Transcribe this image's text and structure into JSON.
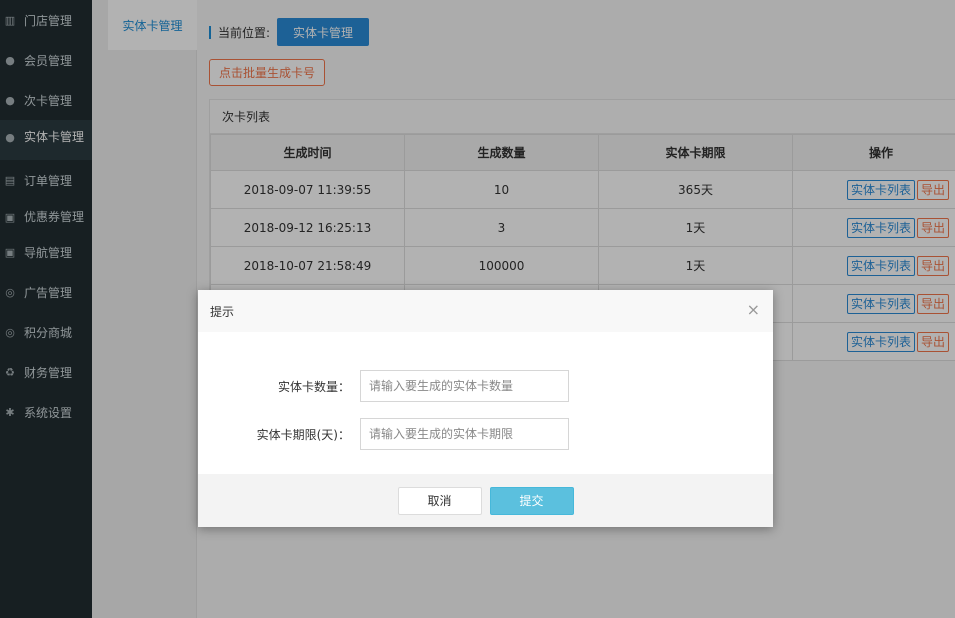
{
  "sidebar": {
    "items": [
      {
        "icon": "bank-icon",
        "glyph": "▥",
        "label": "门店管理"
      },
      {
        "icon": "user-icon",
        "glyph": "●",
        "label": "会员管理"
      },
      {
        "icon": "user-icon",
        "glyph": "●",
        "label": "次卡管理"
      },
      {
        "icon": "user-icon",
        "glyph": "●",
        "label": "实体卡管理"
      },
      {
        "icon": "file-icon",
        "glyph": "▤",
        "label": "订单管理"
      },
      {
        "icon": "money-icon",
        "glyph": "▣",
        "label": "优惠券管理"
      },
      {
        "icon": "money-icon",
        "glyph": "▣",
        "label": "导航管理"
      },
      {
        "icon": "lifering-icon",
        "glyph": "◎",
        "label": "广告管理"
      },
      {
        "icon": "lifering-icon",
        "glyph": "◎",
        "label": "积分商城"
      },
      {
        "icon": "recycle-icon",
        "glyph": "♻",
        "label": "财务管理"
      },
      {
        "icon": "gear-icon",
        "glyph": "✱",
        "label": "系统设置"
      }
    ]
  },
  "submenu": {
    "active_label": "实体卡管理"
  },
  "breadcrumb": {
    "label": "当前位置:",
    "current": "实体卡管理"
  },
  "toolbar": {
    "generate_label": "点击批量生成卡号"
  },
  "panel": {
    "title": "次卡列表",
    "columns": [
      "生成时间",
      "生成数量",
      "实体卡期限",
      "操作"
    ],
    "rows": [
      {
        "time": "2018-09-07 11:39:55",
        "qty": "10",
        "term": "365天"
      },
      {
        "time": "2018-09-12 16:25:13",
        "qty": "3",
        "term": "1天"
      },
      {
        "time": "2018-10-07 21:58:49",
        "qty": "100000",
        "term": "1天"
      },
      {
        "time": "",
        "qty": "",
        "term": ""
      },
      {
        "time": "",
        "qty": "",
        "term": ""
      }
    ],
    "action_list_label": "实体卡列表",
    "action_export_label": "导出"
  },
  "dialog": {
    "title": "提示",
    "close_glyph": "×",
    "qty_label": "实体卡数量：",
    "qty_placeholder": "请输入要生成的实体卡数量",
    "term_label": "实体卡期限(天)：",
    "term_placeholder": "请输入要生成的实体卡期限",
    "cancel_label": "取消",
    "submit_label": "提交"
  }
}
